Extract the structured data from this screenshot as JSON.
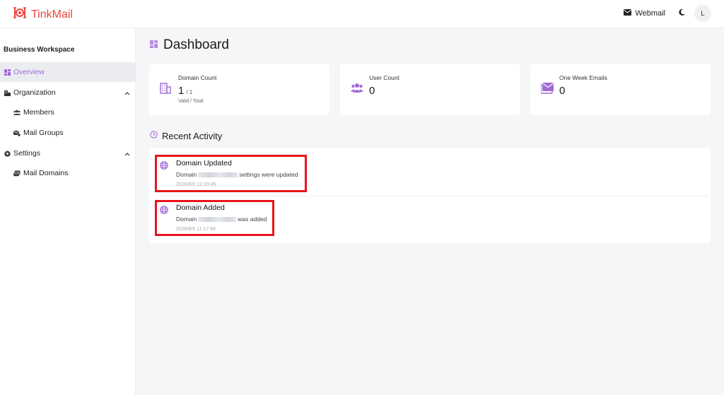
{
  "app": {
    "name": "TinkMail"
  },
  "header": {
    "webmail_label": "Webmail",
    "avatar_initial": "L"
  },
  "sidebar": {
    "workspace_title": "Business Workspace",
    "items": [
      {
        "label": "Overview",
        "icon": "dashboard-icon",
        "active": true
      },
      {
        "label": "Organization",
        "icon": "building-icon",
        "expandable": true
      },
      {
        "label": "Members",
        "icon": "users-icon",
        "sub": true
      },
      {
        "label": "Mail Groups",
        "icon": "mail-group-icon",
        "sub": true
      },
      {
        "label": "Settings",
        "icon": "gear-icon",
        "expandable": true
      },
      {
        "label": "Mail Domains",
        "icon": "mail-domains-icon",
        "sub": true
      }
    ]
  },
  "page": {
    "title": "Dashboard"
  },
  "stats": [
    {
      "label": "Domain Count",
      "value": "1",
      "total": "/ 1",
      "sub": "Valid / Total",
      "icon": "building-icon"
    },
    {
      "label": "User Count",
      "value": "0",
      "icon": "users-icon"
    },
    {
      "label": "One Week Emails",
      "value": "0",
      "icon": "mail-icon"
    }
  ],
  "recent": {
    "title": "Recent Activity",
    "items": [
      {
        "title": "Domain Updated",
        "desc_prefix": "Domain",
        "desc_suffix": "settings were updated",
        "time": "2026/8/6 12:20:45",
        "icon": "globe-icon"
      },
      {
        "title": "Domain Added",
        "desc_prefix": "Domain",
        "desc_suffix": "was added",
        "time": "2026/8/6 11:17:48",
        "icon": "globe-icon"
      }
    ]
  },
  "colors": {
    "brand": "#e8453c",
    "accent": "#a06ad8",
    "highlight": "#e8141b"
  }
}
